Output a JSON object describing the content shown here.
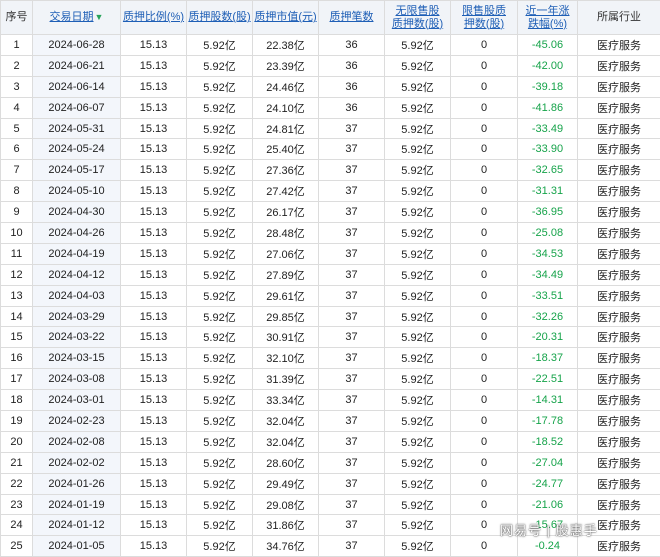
{
  "headers": [
    {
      "label": "序号",
      "link": false
    },
    {
      "label": "交易日期",
      "link": true,
      "sort": "desc"
    },
    {
      "label": "质押比例(%)",
      "link": true
    },
    {
      "label": "质押股数(股)",
      "link": true
    },
    {
      "label": "质押市值(元)",
      "link": true
    },
    {
      "label": "质押笔数",
      "link": true
    },
    {
      "label": "无限售股质押数(股)",
      "link": true,
      "l1": "无限售股",
      "l2": "质押数(股)"
    },
    {
      "label": "限售股质押数(股)",
      "link": true,
      "l1": "限售股质",
      "l2": "押数(股)"
    },
    {
      "label": "近一年涨跌幅(%)",
      "link": true,
      "l1": "近一年涨",
      "l2": "跌幅(%)"
    },
    {
      "label": "所属行业",
      "link": false
    }
  ],
  "rows": [
    [
      "1",
      "2024-06-28",
      "15.13",
      "5.92亿",
      "22.38亿",
      "36",
      "5.92亿",
      "0",
      "-45.06",
      "医疗服务"
    ],
    [
      "2",
      "2024-06-21",
      "15.13",
      "5.92亿",
      "23.39亿",
      "36",
      "5.92亿",
      "0",
      "-42.00",
      "医疗服务"
    ],
    [
      "3",
      "2024-06-14",
      "15.13",
      "5.92亿",
      "24.46亿",
      "36",
      "5.92亿",
      "0",
      "-39.18",
      "医疗服务"
    ],
    [
      "4",
      "2024-06-07",
      "15.13",
      "5.92亿",
      "24.10亿",
      "36",
      "5.92亿",
      "0",
      "-41.86",
      "医疗服务"
    ],
    [
      "5",
      "2024-05-31",
      "15.13",
      "5.92亿",
      "24.81亿",
      "37",
      "5.92亿",
      "0",
      "-33.49",
      "医疗服务"
    ],
    [
      "6",
      "2024-05-24",
      "15.13",
      "5.92亿",
      "25.40亿",
      "37",
      "5.92亿",
      "0",
      "-33.90",
      "医疗服务"
    ],
    [
      "7",
      "2024-05-17",
      "15.13",
      "5.92亿",
      "27.36亿",
      "37",
      "5.92亿",
      "0",
      "-32.65",
      "医疗服务"
    ],
    [
      "8",
      "2024-05-10",
      "15.13",
      "5.92亿",
      "27.42亿",
      "37",
      "5.92亿",
      "0",
      "-31.31",
      "医疗服务"
    ],
    [
      "9",
      "2024-04-30",
      "15.13",
      "5.92亿",
      "26.17亿",
      "37",
      "5.92亿",
      "0",
      "-36.95",
      "医疗服务"
    ],
    [
      "10",
      "2024-04-26",
      "15.13",
      "5.92亿",
      "28.48亿",
      "37",
      "5.92亿",
      "0",
      "-25.08",
      "医疗服务"
    ],
    [
      "11",
      "2024-04-19",
      "15.13",
      "5.92亿",
      "27.06亿",
      "37",
      "5.92亿",
      "0",
      "-34.53",
      "医疗服务"
    ],
    [
      "12",
      "2024-04-12",
      "15.13",
      "5.92亿",
      "27.89亿",
      "37",
      "5.92亿",
      "0",
      "-34.49",
      "医疗服务"
    ],
    [
      "13",
      "2024-04-03",
      "15.13",
      "5.92亿",
      "29.61亿",
      "37",
      "5.92亿",
      "0",
      "-33.51",
      "医疗服务"
    ],
    [
      "14",
      "2024-03-29",
      "15.13",
      "5.92亿",
      "29.85亿",
      "37",
      "5.92亿",
      "0",
      "-32.26",
      "医疗服务"
    ],
    [
      "15",
      "2024-03-22",
      "15.13",
      "5.92亿",
      "30.91亿",
      "37",
      "5.92亿",
      "0",
      "-20.31",
      "医疗服务"
    ],
    [
      "16",
      "2024-03-15",
      "15.13",
      "5.92亿",
      "32.10亿",
      "37",
      "5.92亿",
      "0",
      "-18.37",
      "医疗服务"
    ],
    [
      "17",
      "2024-03-08",
      "15.13",
      "5.92亿",
      "31.39亿",
      "37",
      "5.92亿",
      "0",
      "-22.51",
      "医疗服务"
    ],
    [
      "18",
      "2024-03-01",
      "15.13",
      "5.92亿",
      "33.34亿",
      "37",
      "5.92亿",
      "0",
      "-14.31",
      "医疗服务"
    ],
    [
      "19",
      "2024-02-23",
      "15.13",
      "5.92亿",
      "32.04亿",
      "37",
      "5.92亿",
      "0",
      "-17.78",
      "医疗服务"
    ],
    [
      "20",
      "2024-02-08",
      "15.13",
      "5.92亿",
      "32.04亿",
      "37",
      "5.92亿",
      "0",
      "-18.52",
      "医疗服务"
    ],
    [
      "21",
      "2024-02-02",
      "15.13",
      "5.92亿",
      "28.60亿",
      "37",
      "5.92亿",
      "0",
      "-27.04",
      "医疗服务"
    ],
    [
      "22",
      "2024-01-26",
      "15.13",
      "5.92亿",
      "29.49亿",
      "37",
      "5.92亿",
      "0",
      "-24.77",
      "医疗服务"
    ],
    [
      "23",
      "2024-01-19",
      "15.13",
      "5.92亿",
      "29.08亿",
      "37",
      "5.92亿",
      "0",
      "-21.06",
      "医疗服务"
    ],
    [
      "24",
      "2024-01-12",
      "15.13",
      "5.92亿",
      "31.86亿",
      "37",
      "5.92亿",
      "0",
      "-15.67",
      "医疗服务"
    ],
    [
      "25",
      "2024-01-05",
      "15.13",
      "5.92亿",
      "34.76亿",
      "37",
      "5.92亿",
      "0",
      "-0.24",
      "医疗服务"
    ]
  ],
  "watermark": "网易号 | 股惠手"
}
